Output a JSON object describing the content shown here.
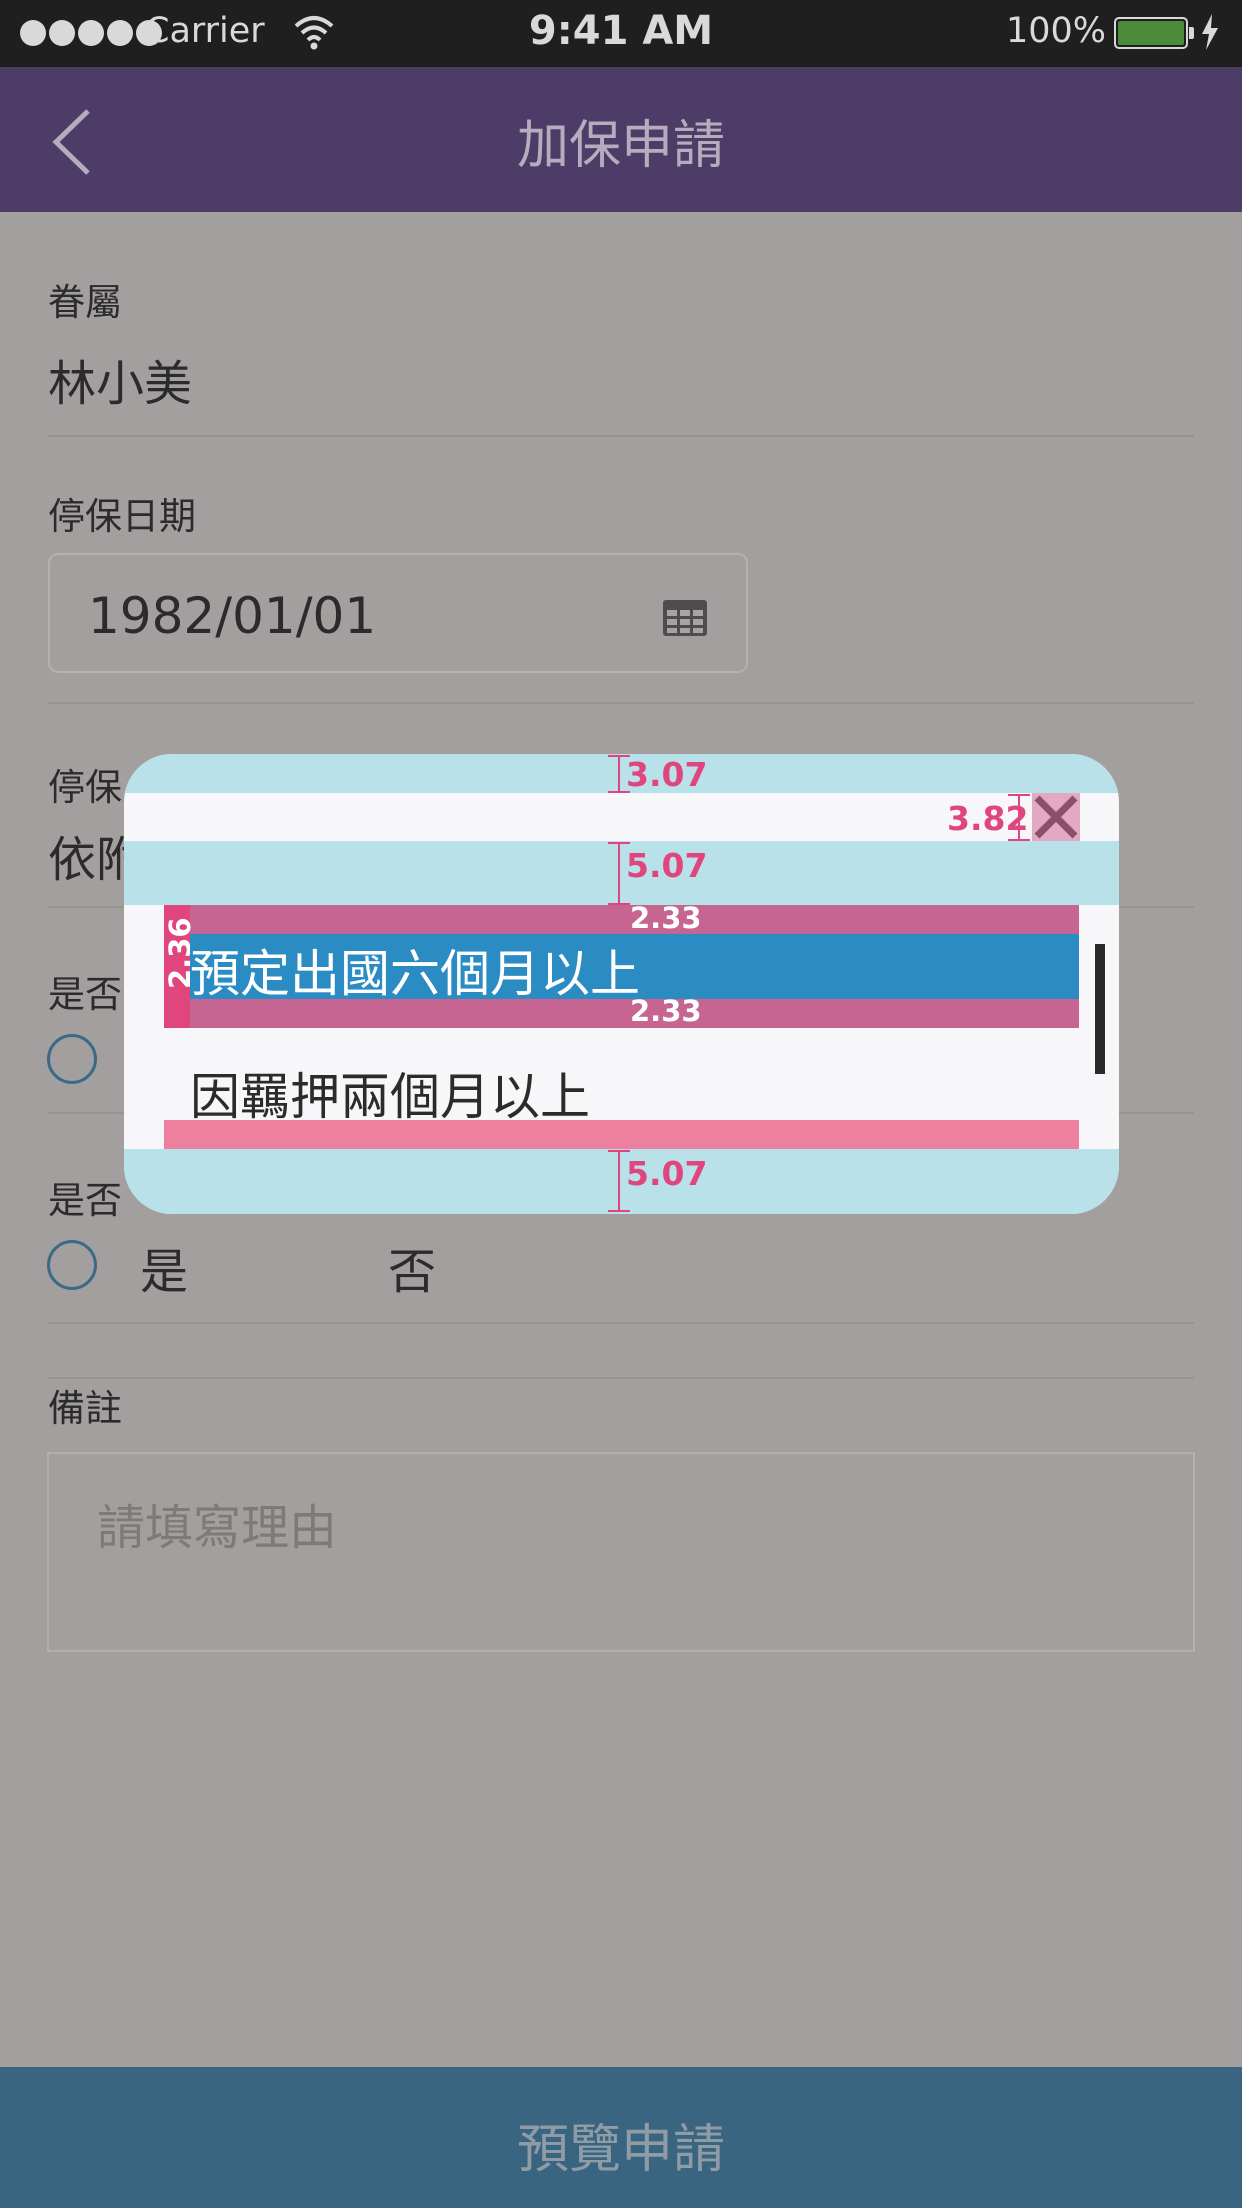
{
  "status_bar": {
    "carrier": "Carrier",
    "time": "9:41 AM",
    "battery": "100%"
  },
  "nav": {
    "title": "加保申請"
  },
  "form": {
    "dependent_label": "眷屬",
    "dependent_value": "林小美",
    "stop_date_label": "停保日期",
    "stop_date_value": "1982/01/01",
    "reason_label_partial": "停保",
    "reason_value_partial": "依附",
    "q1_label_partial": "是否",
    "q2_label_partial": "是否",
    "q2_yes": "是",
    "q2_no": "否",
    "remark_label": "備註",
    "remark_placeholder": "請填寫理由"
  },
  "modal": {
    "options": [
      "預定出國六個月以上",
      "因羈押兩個月以上"
    ],
    "selected_index": 0,
    "spec_top": "3.07",
    "spec_close": "3.82",
    "spec_header_gap": "5.07",
    "spec_item_top": "2.33",
    "spec_item_bottom": "2.33",
    "spec_item_left": "2.36",
    "spec_bottom": "5.07"
  },
  "footer": {
    "button": "預覽申請"
  },
  "colors": {
    "nav_bg": "#4d3c68",
    "footer_bg": "#3a6580",
    "selected": "#2a8cc2",
    "spec_marker": "#e0457d"
  }
}
